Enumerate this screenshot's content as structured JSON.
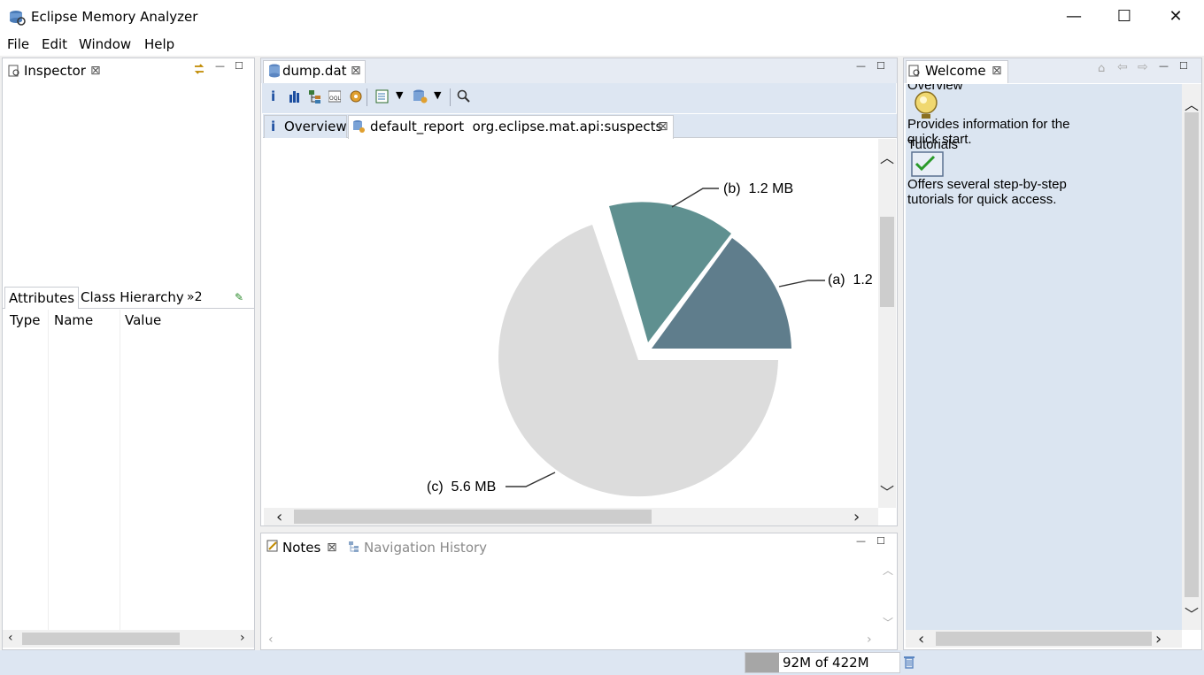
{
  "app": {
    "title": "Eclipse Memory Analyzer"
  },
  "window_controls": {
    "minimize": "—",
    "maximize": "☐",
    "close": "✕"
  },
  "menu": {
    "items": [
      {
        "label": "File"
      },
      {
        "label": "Edit"
      },
      {
        "label": "Window"
      },
      {
        "label": "Help"
      }
    ]
  },
  "inspector": {
    "tab_label": "Inspector",
    "tabs": [
      {
        "label": "Attributes"
      },
      {
        "label": "Class Hierarchy"
      }
    ],
    "overflow_label": "»2",
    "columns": [
      {
        "label": "Type"
      },
      {
        "label": "Name"
      },
      {
        "label": "Value"
      }
    ]
  },
  "editor": {
    "tab_label": "dump.dat",
    "subtabs": [
      {
        "label": "Overview"
      },
      {
        "label": "default_report  org.eclipse.mat.api:suspects"
      }
    ],
    "pie_labels": {
      "a": "(a)  1.2",
      "b": "(b)  1.2 MB",
      "c": "(c)  5.6 MB"
    },
    "colors": {
      "slice_a": "#5f7d8c",
      "slice_b": "#5f9090",
      "slice_c": "#dcdcdc"
    }
  },
  "notes": {
    "tabs": [
      {
        "label": "Notes"
      },
      {
        "label": "Navigation History"
      }
    ]
  },
  "welcome": {
    "tab_label": "Welcome",
    "overview_title": "Overview",
    "overview_desc_1": "Provides information for the",
    "overview_desc_2": "quick start.",
    "tutorials_title": "Tutorials",
    "tutorials_desc_1": "Offers several step-by-step",
    "tutorials_desc_2": "tutorials for quick access."
  },
  "status": {
    "heap": "92M of 422M",
    "heap_used_fraction": 0.22
  }
}
